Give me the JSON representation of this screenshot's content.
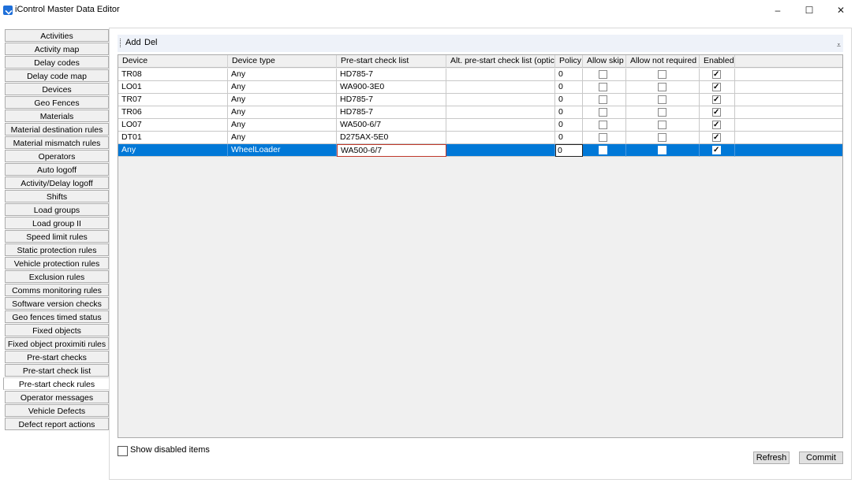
{
  "window": {
    "title": "iControl Master Data Editor",
    "controls": {
      "minimize": "–",
      "maximize": "☐",
      "close": "✕"
    }
  },
  "sidebar": {
    "items": [
      {
        "label": "Activities"
      },
      {
        "label": "Activity map"
      },
      {
        "label": "Delay codes"
      },
      {
        "label": "Delay code map"
      },
      {
        "label": "Devices"
      },
      {
        "label": "Geo Fences"
      },
      {
        "label": "Materials"
      },
      {
        "label": "Material destination rules"
      },
      {
        "label": "Material mismatch rules"
      },
      {
        "label": "Operators"
      },
      {
        "label": "Auto logoff"
      },
      {
        "label": "Activity/Delay logoff"
      },
      {
        "label": "Shifts"
      },
      {
        "label": "Load groups"
      },
      {
        "label": "Load group II"
      },
      {
        "label": "Speed limit rules"
      },
      {
        "label": "Static protection rules"
      },
      {
        "label": "Vehicle protection rules"
      },
      {
        "label": "Exclusion rules"
      },
      {
        "label": "Comms monitoring rules"
      },
      {
        "label": "Software version checks"
      },
      {
        "label": "Geo fences timed status"
      },
      {
        "label": "Fixed objects"
      },
      {
        "label": "Fixed object proximiti rules"
      },
      {
        "label": "Pre-start checks"
      },
      {
        "label": "Pre-start check list"
      },
      {
        "label": "Pre-start check rules",
        "active": true
      },
      {
        "label": "Operator messages"
      },
      {
        "label": "Vehicle Defects"
      },
      {
        "label": "Defect report actions"
      }
    ]
  },
  "toolbar": {
    "add_label": "Add",
    "del_label": "Del",
    "overflow": "⩡"
  },
  "grid": {
    "headers": [
      "Device",
      "Device type",
      "Pre-start check list",
      "Alt. pre-start check list (optic",
      "Policy",
      "Allow skip",
      "Allow not required",
      "Enabled"
    ],
    "rows": [
      {
        "device": "TR08",
        "device_type": "Any",
        "check_list": "HD785-7",
        "alt_list": "",
        "policy": "0",
        "allow_skip": false,
        "allow_not_required": false,
        "enabled": true
      },
      {
        "device": "LO01",
        "device_type": "Any",
        "check_list": "WA900-3E0",
        "alt_list": "",
        "policy": "0",
        "allow_skip": false,
        "allow_not_required": false,
        "enabled": true
      },
      {
        "device": "TR07",
        "device_type": "Any",
        "check_list": "HD785-7",
        "alt_list": "",
        "policy": "0",
        "allow_skip": false,
        "allow_not_required": false,
        "enabled": true
      },
      {
        "device": "TR06",
        "device_type": "Any",
        "check_list": "HD785-7",
        "alt_list": "",
        "policy": "0",
        "allow_skip": false,
        "allow_not_required": false,
        "enabled": true
      },
      {
        "device": "LO07",
        "device_type": "Any",
        "check_list": "WA500-6/7",
        "alt_list": "",
        "policy": "0",
        "allow_skip": false,
        "allow_not_required": false,
        "enabled": true
      },
      {
        "device": "DT01",
        "device_type": "Any",
        "check_list": "D275AX-5E0",
        "alt_list": "",
        "policy": "0",
        "allow_skip": false,
        "allow_not_required": false,
        "enabled": true
      },
      {
        "device": "Any",
        "device_type": "WheelLoader",
        "check_list": "WA500-6/7",
        "alt_list": "",
        "policy": "0",
        "allow_skip": false,
        "allow_not_required": false,
        "enabled": true,
        "selected": true
      }
    ]
  },
  "footer": {
    "show_disabled_label": "Show disabled items",
    "show_disabled_checked": false,
    "refresh_label": "Refresh",
    "commit_label": "Commit"
  }
}
